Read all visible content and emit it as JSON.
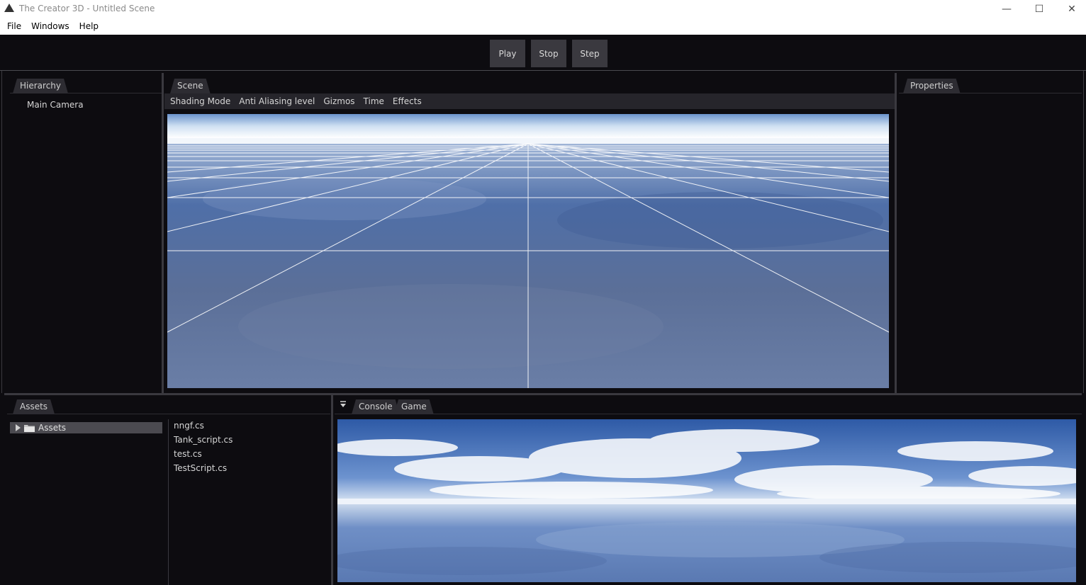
{
  "window": {
    "title": "The Creator 3D - Untitled Scene",
    "minimize_glyph": "—",
    "maximize_glyph": "☐",
    "close_glyph": "✕"
  },
  "menubar": {
    "items": [
      "File",
      "Windows",
      "Help"
    ]
  },
  "toolbar": {
    "play_label": "Play",
    "stop_label": "Stop",
    "step_label": "Step"
  },
  "hierarchy": {
    "tab": "Hierarchy",
    "items": [
      "Main Camera"
    ]
  },
  "scene": {
    "tab": "Scene",
    "menu": [
      "Shading Mode",
      "Anti Aliasing level",
      "Gizmos",
      "Time",
      "Effects"
    ]
  },
  "properties": {
    "tab": "Properties"
  },
  "assets": {
    "tab": "Assets",
    "tree_root": "Assets",
    "files": [
      "nngf.cs",
      "Tank_script.cs",
      "test.cs",
      "TestScript.cs"
    ]
  },
  "bottom_tabs": {
    "console": "Console",
    "game": "Game"
  },
  "colors": {
    "background": "#0d0c10",
    "tab": "#2d2c32",
    "button": "#3a393f",
    "water": "#5a6f95",
    "sky": "#3b62a8"
  }
}
